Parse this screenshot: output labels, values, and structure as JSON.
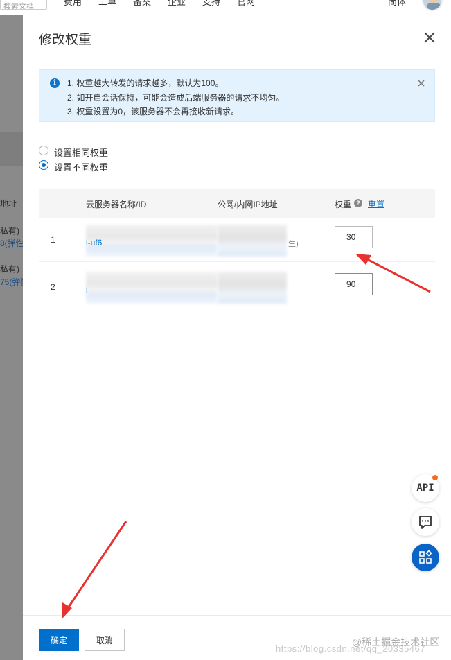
{
  "topnav": {
    "search_placeholder": "搜索文档",
    "items": [
      "费用",
      "工单",
      "备案",
      "企业",
      "支持",
      "官网"
    ],
    "mall": "简体"
  },
  "background": {
    "col_header": "地址",
    "row1_a": "私有)",
    "row1_b": "8(弹性",
    "row2_a": "私有)",
    "row2_b": "75(弹性"
  },
  "drawer": {
    "title": "修改权重",
    "notice": {
      "lines": [
        "1. 权重越大转发的请求越多，默认为100。",
        "2. 如开启会话保持，可能会造成后端服务器的请求不均匀。",
        "3. 权重设置为0，该服务器不会再接收新请求。"
      ]
    },
    "options": {
      "same": "设置相同权重",
      "different": "设置不同权重",
      "selected": "different"
    },
    "table": {
      "columns": {
        "name": "云服务器名称/ID",
        "ip": "公网/内网IP地址",
        "weight": "权重",
        "reset": "重置"
      },
      "rows": [
        {
          "index": "1",
          "id_prefix": "i-uf6",
          "ip_suffix": "生)",
          "weight": "30"
        },
        {
          "index": "2",
          "id_prefix": "i",
          "ip_suffix": "",
          "weight": "90"
        }
      ]
    },
    "footer": {
      "confirm": "确定",
      "cancel": "取消",
      "watermark": "@稀土掘金技术社区",
      "watermark2": "https://blog.csdn.net/qq_20335467"
    }
  },
  "float": {
    "api_label": "API"
  },
  "colors": {
    "primary": "#0070cc",
    "notice_bg": "#e3f2fd",
    "arrow_red": "#e8322f",
    "overlay": "#8a8a8a"
  }
}
